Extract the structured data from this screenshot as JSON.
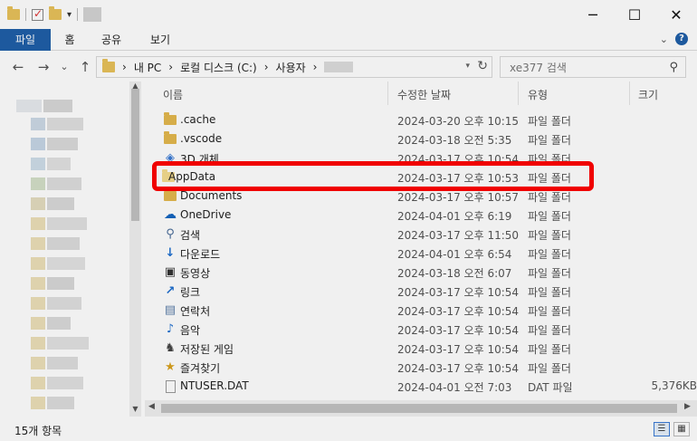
{
  "ribbon": {
    "tabs": [
      "파일",
      "홈",
      "공유",
      "보기"
    ]
  },
  "nav": {
    "back": "←",
    "forward": "→",
    "recent": "⌄",
    "up": "↑"
  },
  "address": {
    "segments": [
      "내 PC",
      "로컬 디스크 (C:)",
      "사용자"
    ],
    "separator": "›"
  },
  "search": {
    "placeholder": "xe377 검색"
  },
  "columns": {
    "name": "이름",
    "date": "수정한 날짜",
    "type": "유형",
    "size": "크기"
  },
  "files": [
    {
      "name": ".cache",
      "date": "2024-03-20 오후 10:15",
      "type": "파일 폴더",
      "size": "",
      "icon": "folder-icon"
    },
    {
      "name": ".vscode",
      "date": "2024-03-18 오전 5:35",
      "type": "파일 폴더",
      "size": "",
      "icon": "folder-icon"
    },
    {
      "name": "3D 개체",
      "date": "2024-03-17 오후 10:54",
      "type": "파일 폴더",
      "size": "",
      "icon": "3d-objects-icon"
    },
    {
      "name": "AppData",
      "date": "2024-03-17 오후 10:53",
      "type": "파일 폴더",
      "size": "",
      "icon": "folder-icon"
    },
    {
      "name": "Documents",
      "date": "2024-03-17 오후 10:57",
      "type": "파일 폴더",
      "size": "",
      "icon": "folder-icon"
    },
    {
      "name": "OneDrive",
      "date": "2024-04-01 오후 6:19",
      "type": "파일 폴더",
      "size": "",
      "icon": "onedrive-icon"
    },
    {
      "name": "검색",
      "date": "2024-03-17 오후 11:50",
      "type": "파일 폴더",
      "size": "",
      "icon": "search-folder-icon"
    },
    {
      "name": "다운로드",
      "date": "2024-04-01 오후 6:54",
      "type": "파일 폴더",
      "size": "",
      "icon": "downloads-icon"
    },
    {
      "name": "동영상",
      "date": "2024-03-18 오전 6:07",
      "type": "파일 폴더",
      "size": "",
      "icon": "videos-icon"
    },
    {
      "name": "링크",
      "date": "2024-03-17 오후 10:54",
      "type": "파일 폴더",
      "size": "",
      "icon": "links-icon"
    },
    {
      "name": "연락처",
      "date": "2024-03-17 오후 10:54",
      "type": "파일 폴더",
      "size": "",
      "icon": "contacts-icon"
    },
    {
      "name": "음악",
      "date": "2024-03-17 오후 10:54",
      "type": "파일 폴더",
      "size": "",
      "icon": "music-icon"
    },
    {
      "name": "저장된 게임",
      "date": "2024-03-17 오후 10:54",
      "type": "파일 폴더",
      "size": "",
      "icon": "saved-games-icon"
    },
    {
      "name": "즐겨찾기",
      "date": "2024-03-17 오후 10:54",
      "type": "파일 폴더",
      "size": "",
      "icon": "favorites-icon"
    },
    {
      "name": "NTUSER.DAT",
      "date": "2024-04-01 오전 7:03",
      "type": "DAT 파일",
      "size": "5,376KB",
      "icon": "file-icon"
    }
  ],
  "status": {
    "item_count": "15개 항목"
  },
  "colors": {
    "file_tab": "#1f5fa8",
    "highlight": "#ff0000",
    "folder": "#e4b84e"
  }
}
